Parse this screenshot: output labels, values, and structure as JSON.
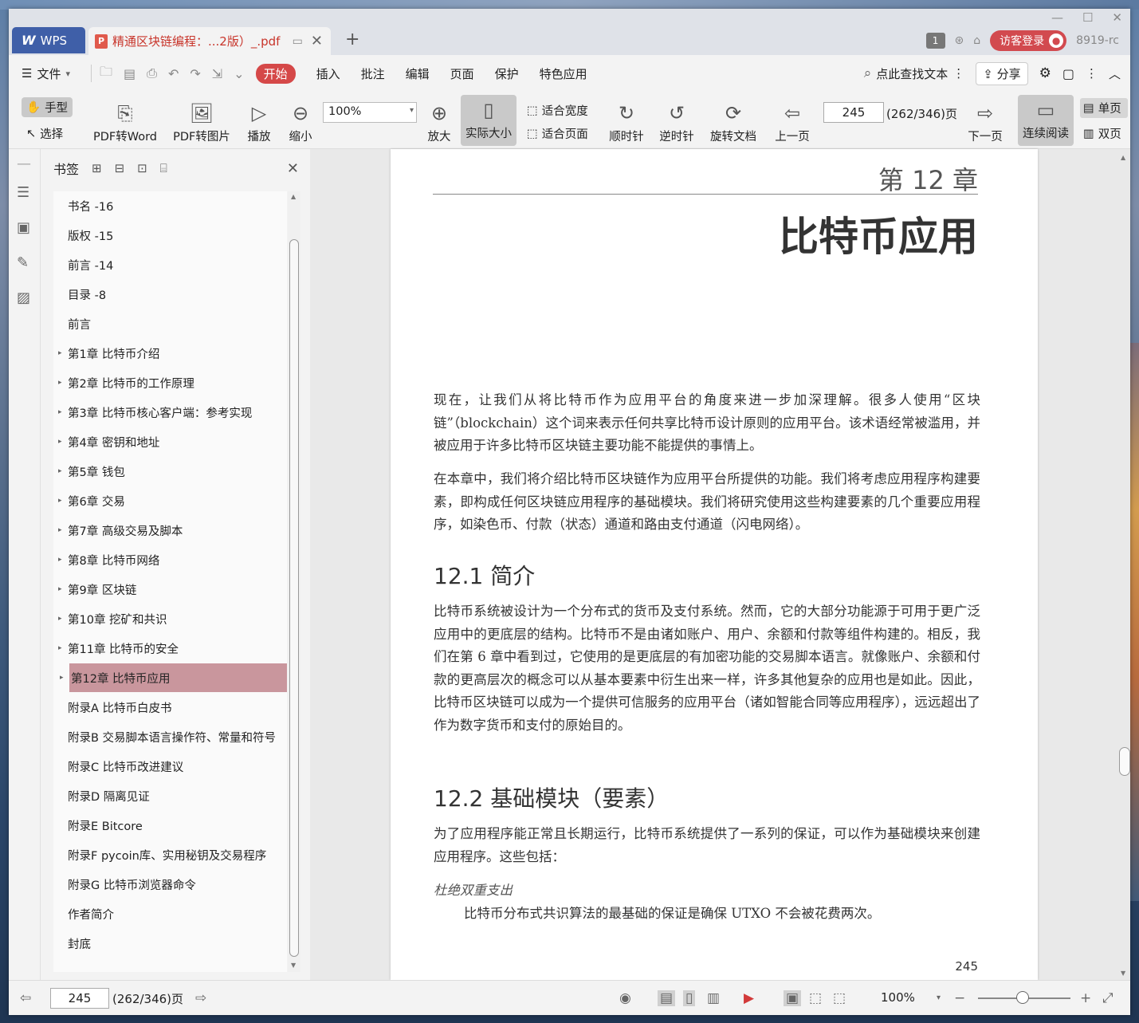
{
  "titlebar": {
    "app_tab": "WPS",
    "doc_tab": "精通区块链编程：...2版）_.pdf",
    "page_badge": "1",
    "login": "访客登录",
    "user": "8919-rc"
  },
  "menu": {
    "file": "文件",
    "start": "开始",
    "items": [
      "插入",
      "批注",
      "编辑",
      "页面",
      "保护",
      "特色应用"
    ],
    "search": "点此查找文本",
    "share": "分享"
  },
  "toolbar": {
    "hand": "手型",
    "select": "选择",
    "pdf2word": "PDF转Word",
    "pdf2img": "PDF转图片",
    "play": "播放",
    "zoom_out": "缩小",
    "zoom": "100%",
    "zoom_in": "放大",
    "actual": "实际大小",
    "fit_width": "适合宽度",
    "fit_page": "适合页面",
    "cw": "顺时针",
    "ccw": "逆时针",
    "rotate": "旋转文档",
    "prev": "上一页",
    "page": "245",
    "page_count": "(262/346)页",
    "next": "下一页",
    "continuous": "连续阅读",
    "single": "单页",
    "double": "双页"
  },
  "sidebar": {
    "title": "书签",
    "items": [
      {
        "label": "书名 -16",
        "arrow": ""
      },
      {
        "label": "版权 -15",
        "arrow": ""
      },
      {
        "label": "前言 -14",
        "arrow": ""
      },
      {
        "label": "目录 -8",
        "arrow": ""
      },
      {
        "label": "前言",
        "arrow": ""
      },
      {
        "label": "第1章 比特币介绍",
        "arrow": "▸"
      },
      {
        "label": "第2章 比特币的工作原理",
        "arrow": "▸"
      },
      {
        "label": "第3章 比特币核心客户端：参考实现",
        "arrow": "▸"
      },
      {
        "label": "第4章 密钥和地址",
        "arrow": "▸"
      },
      {
        "label": "第5章 钱包",
        "arrow": "▸"
      },
      {
        "label": "第6章 交易",
        "arrow": "▸"
      },
      {
        "label": "第7章 高级交易及脚本",
        "arrow": "▸"
      },
      {
        "label": "第8章 比特币网络",
        "arrow": "▸"
      },
      {
        "label": "第9章 区块链",
        "arrow": "▸"
      },
      {
        "label": "第10章 挖矿和共识",
        "arrow": "▸"
      },
      {
        "label": "第11章 比特币的安全",
        "arrow": "▸"
      },
      {
        "label": "第12章 比特币应用",
        "arrow": "▸"
      },
      {
        "label": "附录A 比特币白皮书",
        "arrow": ""
      },
      {
        "label": "附录B 交易脚本语言操作符、常量和符号",
        "arrow": ""
      },
      {
        "label": "附录C 比特币改进建议",
        "arrow": ""
      },
      {
        "label": "附录D 隔离见证",
        "arrow": ""
      },
      {
        "label": "附录E Bitcore",
        "arrow": ""
      },
      {
        "label": "附录F pycoin库、实用秘钥及交易程序",
        "arrow": ""
      },
      {
        "label": "附录G 比特币浏览器命令",
        "arrow": ""
      },
      {
        "label": "作者简介",
        "arrow": ""
      },
      {
        "label": "封底",
        "arrow": ""
      }
    ]
  },
  "page": {
    "chapter": "第 12 章",
    "title": "比特币应用",
    "p1": "现在，让我们从将比特币作为应用平台的角度来进一步加深理解。很多人使用“区块链”（blockchain）这个词来表示任何共享比特币设计原则的应用平台。该术语经常被滥用，并被应用于许多比特币区块链主要功能不能提供的事情上。",
    "p2": "在本章中，我们将介绍比特币区块链作为应用平台所提供的功能。我们将考虑应用程序构建要素，即构成任何区块链应用程序的基础模块。我们将研究使用这些构建要素的几个重要应用程序，如染色币、付款（状态）通道和路由支付通道（闪电网络）。",
    "h1": "12.1 简介",
    "p3": "比特币系统被设计为一个分布式的货币及支付系统。然而，它的大部分功能源于可用于更广泛应用中的更底层的结构。比特币不是由诸如账户、用户、余额和付款等组件构建的。相反，我们在第 6 章中看到过，它使用的是更底层的有加密功能的交易脚本语言。就像账户、余额和付款的更高层次的概念可以从基本要素中衍生出来一样，许多其他复杂的应用也是如此。因此，比特币区块链可以成为一个提供可信服务的应用平台（诸如智能合同等应用程序），远远超出了作为数字货币和支付的原始目的。",
    "h2": "12.2 基础模块（要素）",
    "p4": "为了应用程序能正常且长期运行，比特币系统提供了一系列的保证，可以作为基础模块来创建应用程序。这些包括：",
    "term": "杜绝双重支出",
    "p5": "比特币分布式共识算法的最基础的保证是确保 UTXO 不会被花费两次。",
    "number": "245"
  },
  "status": {
    "page": "245",
    "page_count": "(262/346)页",
    "zoom": "100%"
  }
}
